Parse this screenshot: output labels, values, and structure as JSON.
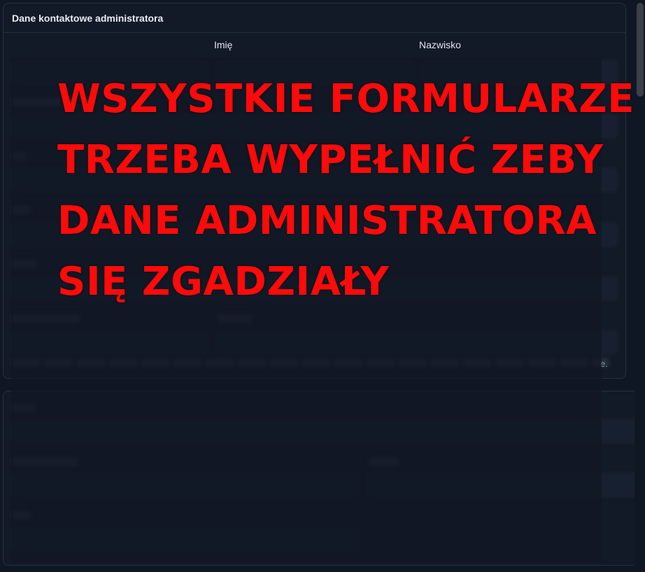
{
  "card": {
    "title": "Dane kontaktowe administratora"
  },
  "columns": {
    "first_name": "Imię",
    "last_name": "Nazwisko"
  },
  "hint_tail": "e.",
  "banner": {
    "lines": [
      "WSZYSTKIE FORMULARZE",
      "TRZEBA WYPEŁNIĆ ZEBY",
      "DANE ADMINISTRATORA",
      "SIĘ ZGADZIAŁY"
    ]
  },
  "colors": {
    "banner": "#ff0a0a",
    "background": "#101724",
    "card": "#121a28",
    "border": "#262f3d"
  }
}
